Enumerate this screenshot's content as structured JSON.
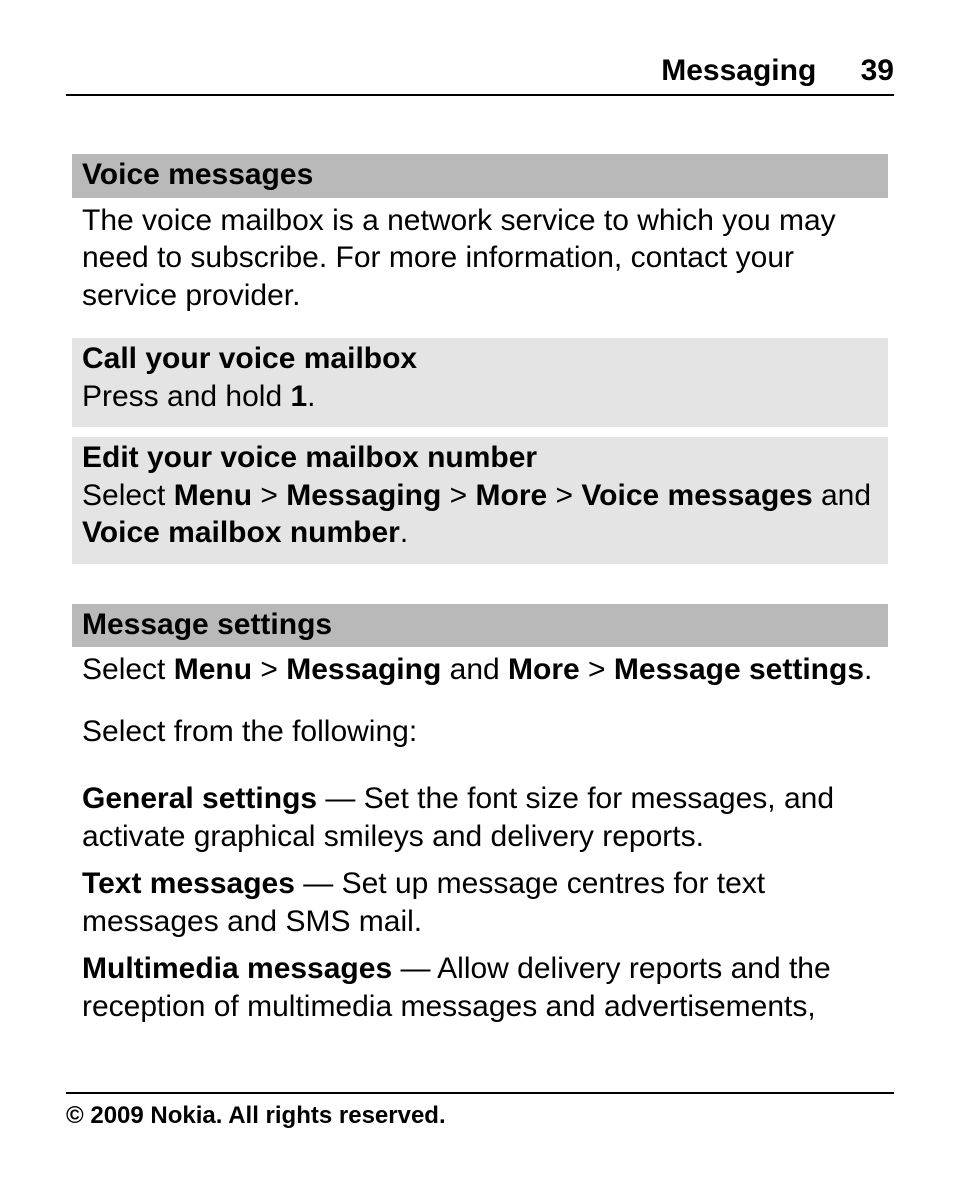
{
  "header": {
    "section": "Messaging",
    "page": "39"
  },
  "voice": {
    "title": "Voice messages",
    "intro": "The voice mailbox is a network service to which you may need to subscribe. For more information, contact your service provider.",
    "call": {
      "title": "Call your voice mailbox",
      "body_pre": "Press and hold ",
      "body_bold": "1",
      "body_post": "."
    },
    "edit": {
      "title": "Edit your voice mailbox number",
      "select_word": "Select ",
      "menu": "Menu",
      "sep": " > ",
      "messaging": "Messaging",
      "more": "More",
      "voice_messages": "Voice messages",
      "and_word": " and ",
      "voice_mailbox_number": "Voice mailbox number",
      "period": "."
    }
  },
  "settings": {
    "title": "Message settings",
    "path": {
      "select_word": "Select ",
      "menu": "Menu",
      "sep": " > ",
      "messaging": "Messaging",
      "and_word": " and ",
      "more": "More",
      "msg_settings": "Message settings",
      "period": "."
    },
    "select_from": "Select from the following:",
    "items": {
      "general_label": "General settings",
      "general_body": " — Set the font size for messages, and activate graphical smileys and delivery reports.",
      "text_label": "Text messages",
      "text_body": " — Set up message centres for text messages and SMS mail.",
      "mm_label": "Multimedia messages",
      "mm_body": " — Allow delivery reports and the reception of multimedia messages and advertisements,"
    }
  },
  "footer": "© 2009 Nokia. All rights reserved."
}
